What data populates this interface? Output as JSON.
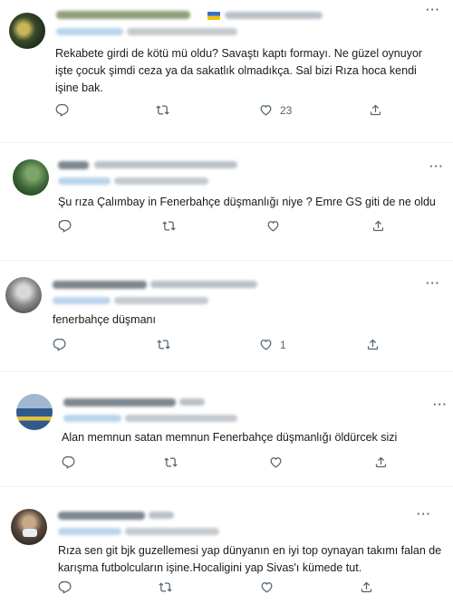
{
  "tweets": [
    {
      "text": "Rekabete girdi de kötü mü oldu? Savaştı kaptı formayı. Ne güzel oynuyor işte çocuk şimdi ceza ya da sakatlık olmadıkça. Sal bizi Rıza hoca kendi işine bak.",
      "likes": "23",
      "icons": [
        "reply-icon",
        "retweet-icon",
        "heart-icon",
        "share-icon"
      ]
    },
    {
      "text": "Şu rıza Çalımbay in Fenerbahçe düşmanlığı niye ? Emre GS giti de ne oldu .",
      "likes": "",
      "icons": [
        "reply-icon",
        "retweet-icon",
        "heart-icon",
        "share-icon"
      ]
    },
    {
      "text": "fenerbahçe düşmanı",
      "likes": "1",
      "icons": [
        "reply-icon",
        "retweet-icon",
        "heart-icon",
        "share-icon"
      ]
    },
    {
      "text": "Alan memnun satan memnun Fenerbahçe düşmanlığı öldürcek sizi",
      "likes": "",
      "icons": [
        "reply-icon",
        "retweet-icon",
        "heart-icon",
        "share-icon"
      ]
    },
    {
      "text": "Rıza sen git bjk guzellemesi yap dünyanın en iyi top oynayan takımı falan de karışma futbolcuların işine.Hocaligini yap Sivas'ı kümede tut.",
      "likes": "",
      "icons": [
        "reply-icon",
        "retweet-icon",
        "heart-icon",
        "share-icon"
      ]
    }
  ],
  "more_label": "···",
  "colors": {
    "icon": "#536471",
    "reply_blur": "#b9d4ec",
    "divider": "#eff3f4"
  }
}
